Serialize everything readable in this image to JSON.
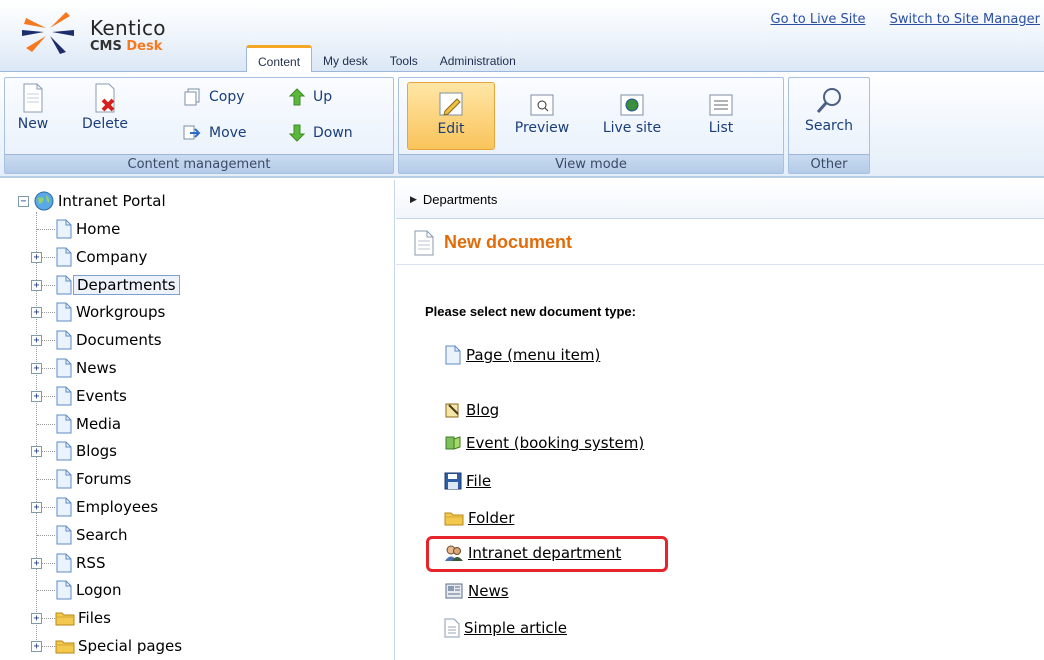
{
  "header": {
    "brand": "Kentico",
    "product_prefix": "CMS ",
    "product_suffix": "Desk",
    "links": [
      "Go to Live Site",
      "Switch to Site Manager"
    ],
    "tabs": [
      "Content",
      "My desk",
      "Tools",
      "Administration"
    ],
    "active_tab": "Content"
  },
  "ribbon": {
    "content_management": {
      "label": "Content management",
      "new": "New",
      "delete": "Delete",
      "copy": "Copy",
      "move": "Move",
      "up": "Up",
      "down": "Down"
    },
    "view_mode": {
      "label": "View mode",
      "edit": "Edit",
      "preview": "Preview",
      "live_site": "Live site",
      "list": "List"
    },
    "other": {
      "label": "Other",
      "search": "Search"
    }
  },
  "tree": {
    "root": "Intranet Portal",
    "selected": "Departments",
    "items": [
      {
        "label": "Home",
        "expandable": false,
        "icon": "page-icon"
      },
      {
        "label": "Company",
        "expandable": true,
        "icon": "page-icon"
      },
      {
        "label": "Departments",
        "expandable": true,
        "icon": "page-icon"
      },
      {
        "label": "Workgroups",
        "expandable": true,
        "icon": "page-icon"
      },
      {
        "label": "Documents",
        "expandable": true,
        "icon": "page-icon"
      },
      {
        "label": "News",
        "expandable": true,
        "icon": "page-icon"
      },
      {
        "label": "Events",
        "expandable": true,
        "icon": "page-icon"
      },
      {
        "label": "Media",
        "expandable": false,
        "icon": "page-icon"
      },
      {
        "label": "Blogs",
        "expandable": true,
        "icon": "page-icon"
      },
      {
        "label": "Forums",
        "expandable": false,
        "icon": "page-icon"
      },
      {
        "label": "Employees",
        "expandable": true,
        "icon": "page-icon"
      },
      {
        "label": "Search",
        "expandable": false,
        "icon": "page-icon"
      },
      {
        "label": "RSS",
        "expandable": true,
        "icon": "page-icon"
      },
      {
        "label": "Logon",
        "expandable": false,
        "icon": "page-icon"
      },
      {
        "label": "Files",
        "expandable": true,
        "icon": "folder-icon"
      },
      {
        "label": "Special pages",
        "expandable": true,
        "icon": "folder-icon"
      }
    ]
  },
  "content": {
    "breadcrumb": "Departments",
    "title": "New document",
    "prompt": "Please select new document type:",
    "doc_types": [
      {
        "label": "Page (menu item)",
        "icon": "page-icon"
      },
      {
        "label": "Blog",
        "icon": "blog-icon"
      },
      {
        "label": "Event (booking system)",
        "icon": "event-icon"
      },
      {
        "label": "File",
        "icon": "file-disk-icon"
      },
      {
        "label": "Folder",
        "icon": "folder-icon"
      },
      {
        "label": "Intranet department",
        "icon": "department-people-icon"
      },
      {
        "label": "News",
        "icon": "news-icon"
      },
      {
        "label": "Simple article",
        "icon": "article-icon"
      }
    ],
    "highlighted": "Intranet department"
  },
  "colors": {
    "accent_orange": "#e36c0a",
    "highlight_red": "#e8242b",
    "link_blue": "#2a4fa0",
    "ribbon_border": "#a9c1e0"
  }
}
